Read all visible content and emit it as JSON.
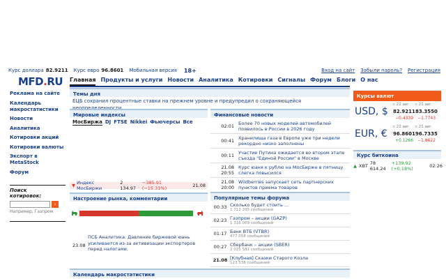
{
  "topbar": {
    "usd_label": "Курс доллара",
    "usd_value": "82.9211",
    "eur_label": "Курс евро",
    "eur_value": "96.8601",
    "mobile": "Мобильная версия",
    "age": "18+",
    "login": "Вход на сайт",
    "forgot": "Забыли пароль?",
    "register": "Регистрация"
  },
  "logo": {
    "main": "MFD",
    "dot": ".",
    "tld": "RU"
  },
  "nav": [
    "Главная",
    "Продукты и услуги",
    "Новости",
    "Аналитика",
    "Котировки",
    "Сигналы",
    "Форум",
    "Блоги",
    "О нас"
  ],
  "left_menu": [
    "Реклама на сайте",
    "Календарь макростатистики",
    "Новости",
    "Аналитика",
    "Котировки акций",
    "Котировки валюты",
    "Экспорт в MetaStock",
    "Форум"
  ],
  "search": {
    "title": "Поиск котировок:",
    "hint": "Например, Газпром"
  },
  "themes": {
    "title": "Темы дня",
    "text": "ЕЦБ сохранил процентные ставки на прежнем уровне и предупредил о сохраняющейся неопределенности"
  },
  "indices": {
    "title": "Мировые индексы",
    "tabs": [
      "МосБиржа",
      "DJ",
      "FTSE",
      "Nikkei",
      "Фьючерсы",
      "Все"
    ],
    "row": {
      "name": "Индекс МосБиржи",
      "value": "2 134.97",
      "change": "−385.91 (−15.31%)",
      "time": "21.08"
    }
  },
  "fin_news": {
    "title": "Финансовые новости",
    "items": [
      {
        "time": "02:01",
        "text": "Более 70 новых моделей автомобилей появилось в России в 2026 году"
      },
      {
        "time": "00:41",
        "text": "Хранилища газа в Европе уже три недели рекордно низко заполнены"
      },
      {
        "time": "00:11",
        "text": "Участие Путина ожидается во втором этапе съезда \"Единой России\" в Москве"
      },
      {
        "time": "21.08 20:55",
        "text": "Курс юаня к рублю на МосБирже в пятницу слегка повысился"
      },
      {
        "time": "21.08 20:00",
        "text": "Wildberries запускает сеть партнерских пунктов приема товаров"
      }
    ]
  },
  "market_mood": {
    "title": "Настроение рынка, комментарии",
    "neg_share": 0.52,
    "item": {
      "date": "23.08",
      "text": "ПСБ Аналитика: Давление биржевой юань усиливается из-за активизации экспортеров перед налогами."
    }
  },
  "forum": {
    "title": "Популярные темы форума",
    "items": [
      {
        "time": "00:33",
        "title": "Сколько будет стоить ...",
        "count": "1 712 205 сообщений"
      },
      {
        "time": "02:23",
        "title": "Газпром – акции (GAZP)",
        "count": "1 316 069 сообщений"
      },
      {
        "time": "01:17",
        "title": "Банк ВТБ (VTBR)",
        "count": "477 058 сообщений"
      },
      {
        "time": "00:27",
        "title": "Сбербанк – акции (SBER)",
        "count": "2 025 581 сообщений"
      },
      {
        "time": "21.08",
        "title": "[Клубная] Сказки Старого Козла",
        "count": "123 538 сообщений"
      }
    ]
  },
  "calendar": {
    "title": "Календарь макростатистики"
  },
  "currency": {
    "title": "Курсы валют",
    "rows": [
      {
        "symbol": "USD, $",
        "h1": "с 22 авг.",
        "h2": "с 21 авг.",
        "v1": "82.9211",
        "v2": "83.3550",
        "c1": "−0.4339",
        "c2": "−1.7743"
      },
      {
        "symbol": "EUR, €",
        "h1": "с 22 авг.",
        "h2": "с 21 авг.",
        "v1": "96.8601",
        "v2": "96.7335",
        "c1": "+0.1266",
        "c2": "−1.8622"
      }
    ]
  },
  "btc": {
    "title": "Курс биткоина",
    "ticker": "ХВТ",
    "value": "78 614.24",
    "change": "+139.92 (+0.18%)",
    "time": "02:26"
  },
  "colors": {
    "brand": "#1a3f8a",
    "accent": "#f05a1a",
    "negative": "#d4372c",
    "positive": "#2e9a3a"
  }
}
